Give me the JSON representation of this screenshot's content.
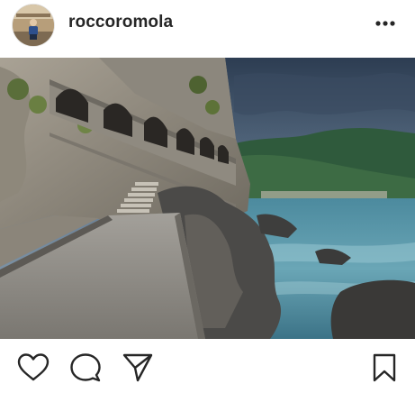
{
  "post": {
    "username": "roccoromola",
    "avatar_icon": "profile-photo",
    "more_icon": "ellipsis-icon",
    "photo_description_icon": "coastal-photo"
  },
  "actions": {
    "like_icon": "heart-icon",
    "comment_icon": "speech-bubble-icon",
    "share_icon": "paper-plane-icon",
    "save_icon": "bookmark-icon"
  }
}
